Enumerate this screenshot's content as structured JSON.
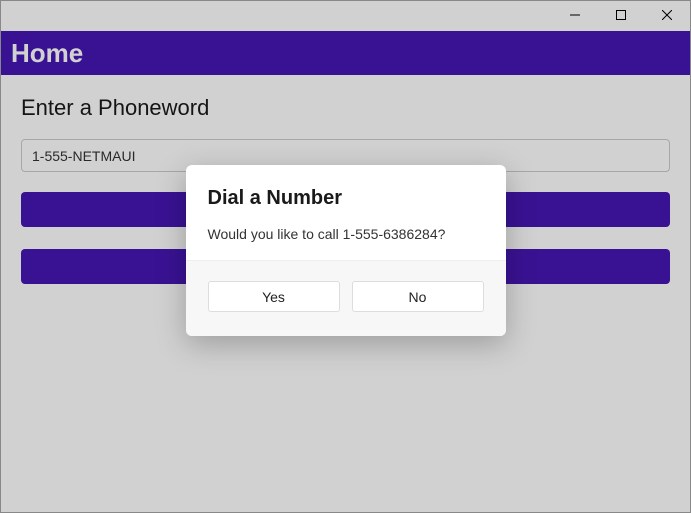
{
  "window": {
    "minimize": "minimize",
    "maximize": "maximize",
    "close": "close"
  },
  "header": {
    "title": "Home"
  },
  "main": {
    "label": "Enter a Phoneword",
    "input_value": "1-555-NETMAUI",
    "translate_button": "",
    "call_button": ""
  },
  "dialog": {
    "title": "Dial a Number",
    "message": "Would you like to call 1-555-6386284?",
    "yes_label": "Yes",
    "no_label": "No"
  },
  "colors": {
    "accent": "#4617b4"
  }
}
